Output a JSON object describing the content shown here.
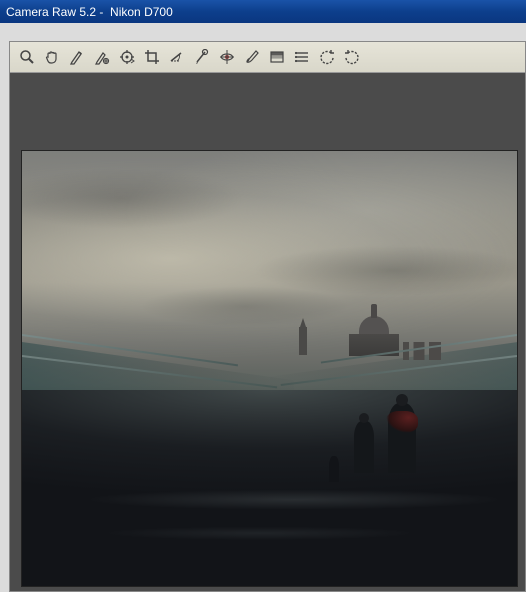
{
  "window": {
    "app_name": "Camera Raw 5.2",
    "separator": " - ",
    "camera_model": " Nikon D700"
  },
  "toolbar": {
    "tools": [
      {
        "name": "zoom-tool-icon",
        "title": "Zoom Tool"
      },
      {
        "name": "hand-tool-icon",
        "title": "Hand Tool"
      },
      {
        "name": "white-balance-tool-icon",
        "title": "White Balance Tool"
      },
      {
        "name": "color-sampler-tool-icon",
        "title": "Color Sampler Tool"
      },
      {
        "name": "targeted-adjustment-tool-icon",
        "title": "Targeted Adjustment Tool"
      },
      {
        "name": "crop-tool-icon",
        "title": "Crop Tool"
      },
      {
        "name": "straighten-tool-icon",
        "title": "Straighten Tool"
      },
      {
        "name": "spot-removal-tool-icon",
        "title": "Spot Removal Tool"
      },
      {
        "name": "red-eye-removal-tool-icon",
        "title": "Red Eye Removal Tool"
      },
      {
        "name": "adjustment-brush-tool-icon",
        "title": "Adjustment Brush"
      },
      {
        "name": "graduated-filter-tool-icon",
        "title": "Graduated Filter"
      },
      {
        "name": "preferences-icon",
        "title": "Open Preferences"
      },
      {
        "name": "rotate-ccw-icon",
        "title": "Rotate Counterclockwise"
      },
      {
        "name": "rotate-cw-icon",
        "title": "Rotate Clockwise"
      }
    ]
  }
}
